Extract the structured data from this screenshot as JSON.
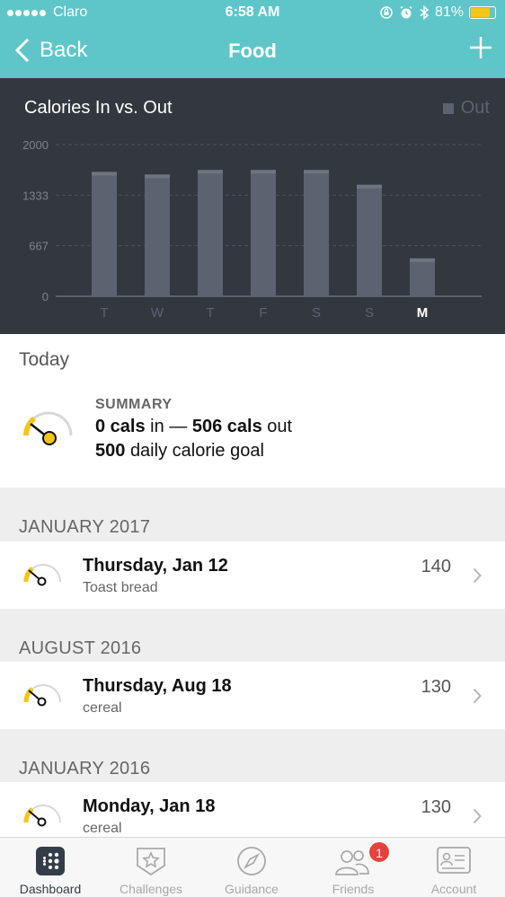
{
  "status_bar": {
    "carrier": "Claro",
    "time": "6:58 AM",
    "battery": "81%",
    "battery_level": 0.81,
    "icons": [
      "signal-dots-icon",
      "orientation-lock-icon",
      "alarm-icon",
      "bluetooth-icon",
      "battery-icon"
    ]
  },
  "nav": {
    "back_label": "Back",
    "title": "Food",
    "add_icon": "plus-icon"
  },
  "chart_data": {
    "type": "bar",
    "title": "Calories In vs. Out",
    "legend": [
      {
        "name": "Out",
        "color": "#5c6270",
        "placement": "top-right"
      }
    ],
    "categories": [
      "T",
      "W",
      "T",
      "F",
      "S",
      "S",
      "M"
    ],
    "highlighted_category_index": 6,
    "series": [
      {
        "name": "Out",
        "values": [
          1640,
          1605,
          1665,
          1665,
          1665,
          1470,
          500
        ]
      }
    ],
    "ylim": [
      0,
      2000
    ],
    "yticks": [
      "2000",
      "1333",
      "667",
      "0"
    ],
    "ytick_values": [
      2000,
      1333,
      667,
      0
    ],
    "grid": true,
    "colors": {
      "bar": "#5c6270",
      "bar_cap": "#6e7480",
      "grid": "#4c525c",
      "background": "#33383f"
    }
  },
  "today": {
    "label": "Today",
    "summary_heading": "SUMMARY",
    "cals_in": "0 cals",
    "in_word": "in —",
    "cals_out": "506 cals",
    "out_word": "out",
    "goal_value": "500",
    "goal_text": "daily calorie goal"
  },
  "sections": [
    {
      "header": "JANUARY 2017",
      "entries": [
        {
          "date": "Thursday, Jan 12",
          "desc": "Toast bread",
          "cals": "140"
        }
      ]
    },
    {
      "header": "AUGUST 2016",
      "entries": [
        {
          "date": "Thursday, Aug 18",
          "desc": "cereal",
          "cals": "130"
        }
      ]
    },
    {
      "header": "JANUARY 2016",
      "entries": [
        {
          "date": "Monday, Jan 18",
          "desc": "cereal",
          "cals": "130"
        }
      ]
    }
  ],
  "tabs": [
    {
      "label": "Dashboard",
      "icon": "dashboard-icon",
      "active": true
    },
    {
      "label": "Challenges",
      "icon": "challenges-star-icon",
      "active": false
    },
    {
      "label": "Guidance",
      "icon": "compass-icon",
      "active": false
    },
    {
      "label": "Friends",
      "icon": "friends-icon",
      "active": false,
      "badge": "1"
    },
    {
      "label": "Account",
      "icon": "account-card-icon",
      "active": false
    }
  ],
  "colors": {
    "accent": "#5ec6c8",
    "gauge_yellow": "#f5c518",
    "badge_red": "#e8413b"
  }
}
